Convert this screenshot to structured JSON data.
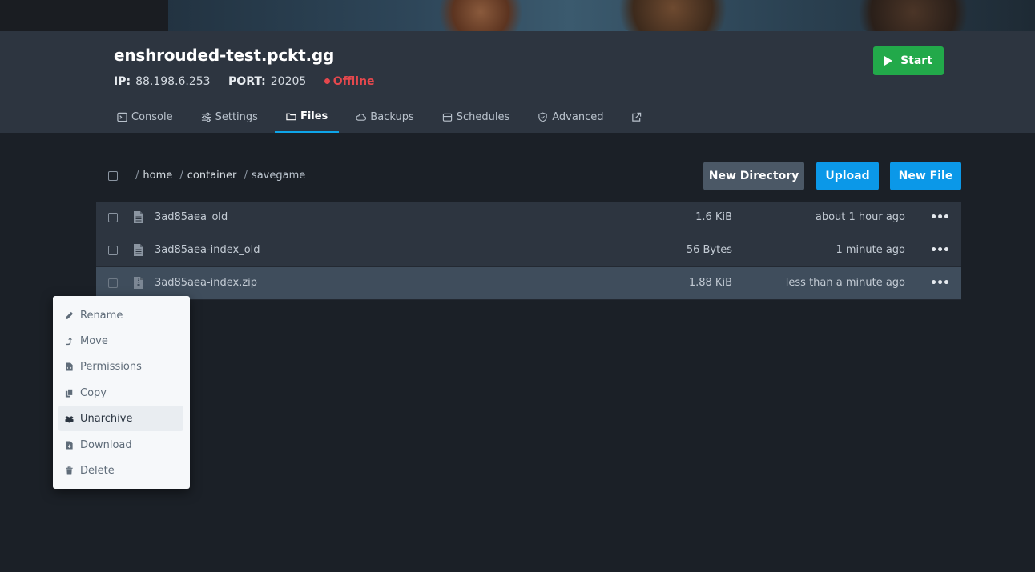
{
  "server": {
    "name": "enshrouded-test.pckt.gg",
    "ip_label": "IP:",
    "ip": "88.198.6.253",
    "port_label": "PORT:",
    "port": "20205",
    "status": "Offline",
    "start_label": "Start"
  },
  "tabs": [
    {
      "label": "Console",
      "icon": "terminal-icon"
    },
    {
      "label": "Settings",
      "icon": "sliders-icon"
    },
    {
      "label": "Files",
      "icon": "folder-icon",
      "active": true
    },
    {
      "label": "Backups",
      "icon": "cloud-icon"
    },
    {
      "label": "Schedules",
      "icon": "calendar-icon"
    },
    {
      "label": "Advanced",
      "icon": "shield-icon"
    }
  ],
  "breadcrumb": [
    "home",
    "container",
    "savegame"
  ],
  "toolbar": {
    "new_directory": "New Directory",
    "upload": "Upload",
    "new_file": "New File"
  },
  "files": [
    {
      "name": "3ad85aea_old",
      "size": "1.6 KiB",
      "modified": "about 1 hour ago",
      "icon": "file-icon"
    },
    {
      "name": "3ad85aea-index_old",
      "size": "56 Bytes",
      "modified": "1 minute ago",
      "icon": "file-icon"
    },
    {
      "name": "3ad85aea-index.zip",
      "size": "1.88 KiB",
      "modified": "less than a minute ago",
      "icon": "archive-file-icon"
    }
  ],
  "context_menu": [
    {
      "label": "Rename",
      "icon": "pencil-icon"
    },
    {
      "label": "Move",
      "icon": "move-icon"
    },
    {
      "label": "Permissions",
      "icon": "permissions-file-icon"
    },
    {
      "label": "Copy",
      "icon": "copy-icon"
    },
    {
      "label": "Unarchive",
      "icon": "boxes-icon"
    },
    {
      "label": "Download",
      "icon": "download-file-icon"
    },
    {
      "label": "Delete",
      "icon": "trash-icon"
    }
  ],
  "colors": {
    "background": "#1b2027",
    "header": "#2d3540",
    "accent_blue": "#0b98e8",
    "start_green": "#22a94a",
    "offline_red": "#e5484d"
  }
}
